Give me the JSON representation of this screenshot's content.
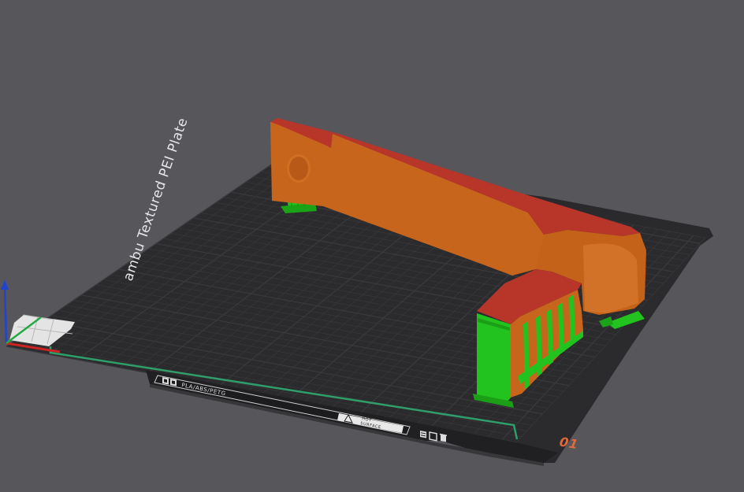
{
  "viewport": {
    "background": "#56565b"
  },
  "build_plate": {
    "name": "Bambu Textured PEI Plate",
    "name_visible": "ambu Textured PEI Plate",
    "filament_label": "PLA/ABS/PETG",
    "surface_label_line1": "HOT",
    "surface_label_line2": "SURFACE",
    "plate_number": "01",
    "plate_color": "#2b2b2d",
    "grid_color": "#3a3a3d",
    "edge_line_color": "#2f9e6a",
    "plate_number_color": "#e06a3c"
  },
  "model": {
    "body_color": "#c7651c",
    "top_surface_color": "#b8352a",
    "support_color": "#22c31f"
  },
  "axes": {
    "x_color": "#cc2222",
    "y_color": "#22aa44",
    "z_color": "#2244cc"
  },
  "icons": {
    "plate_type_icon": "qr-code-icon",
    "hot_surface_icon": "warning-triangle-icon",
    "plate_action_icons": [
      "select-plate-icon",
      "slice-plate-icon",
      "delete-plate-icon"
    ]
  }
}
